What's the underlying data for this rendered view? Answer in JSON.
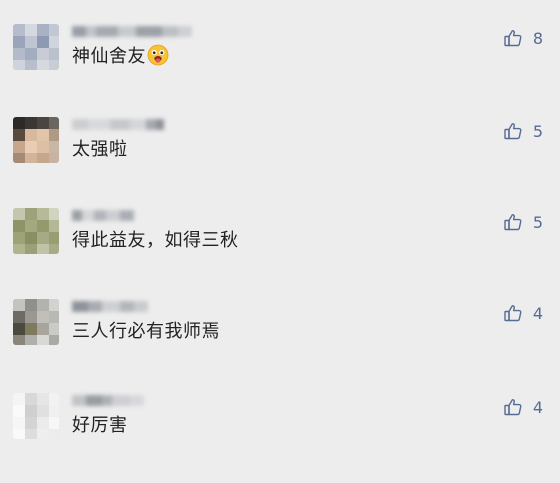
{
  "comments": [
    {
      "text": "神仙舍友",
      "emoji": "tongue-out-emoji",
      "likes": "8"
    },
    {
      "text": "太强啦",
      "likes": "5"
    },
    {
      "text": "得此益友，如得三秋",
      "likes": "5"
    },
    {
      "text": "三人行必有我师焉",
      "likes": "4"
    },
    {
      "text": "好厉害",
      "likes": "4"
    }
  ],
  "colors": {
    "background": "#ededed",
    "like_blue": "#576b95",
    "text": "#222222"
  }
}
